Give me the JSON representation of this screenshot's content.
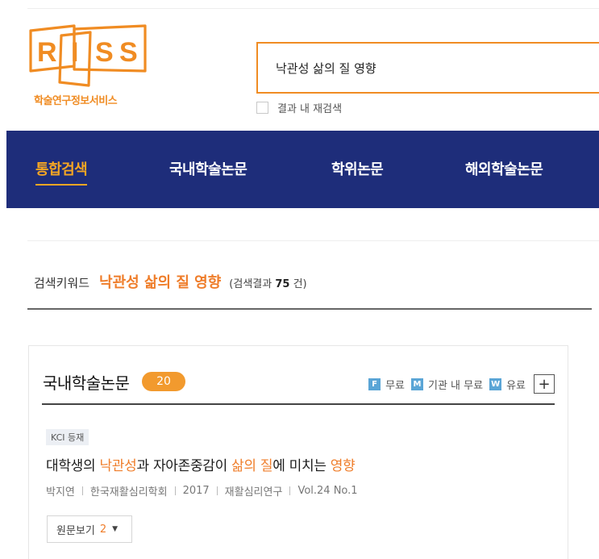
{
  "logo": {
    "letters": [
      "R",
      "I",
      "S",
      "S"
    ],
    "subtitle": "학술연구정보서비스",
    "accent_color": "#f08c23"
  },
  "search": {
    "value": "낙관성 삶의 질 영향",
    "research_label": "결과 내 재검색",
    "research_checked": false
  },
  "nav": {
    "background": "#1e2d7a",
    "active_color": "#f5a623",
    "items": [
      {
        "label": "통합검색",
        "active": true
      },
      {
        "label": "국내학술논문",
        "active": false
      },
      {
        "label": "학위논문",
        "active": false
      },
      {
        "label": "해외학술논문",
        "active": false
      }
    ]
  },
  "summary": {
    "keyword_label": "검색키워드",
    "keyword": "낙관성 삶의 질 영향",
    "result_prefix": "(검색결과 ",
    "result_count": "75",
    "result_suffix": " 건)"
  },
  "section": {
    "title": "국내학술논문",
    "count": "20",
    "legend": [
      {
        "badge": "F",
        "label": "무료",
        "icon": "free-badge-icon"
      },
      {
        "badge": "M",
        "label": "기관 내 무료",
        "icon": "institution-free-badge-icon"
      },
      {
        "badge": "W",
        "label": "유료",
        "icon": "paid-badge-icon"
      }
    ],
    "expand_symbol": "+"
  },
  "result": {
    "tag": "KCI 등재",
    "title_parts": [
      {
        "text": "대학생의 ",
        "hl": false
      },
      {
        "text": "낙관성",
        "hl": true
      },
      {
        "text": "과 자아존중감이 ",
        "hl": false
      },
      {
        "text": "삶의 질",
        "hl": true
      },
      {
        "text": "에 미치는 ",
        "hl": false
      },
      {
        "text": "영향",
        "hl": true
      }
    ],
    "meta": [
      "박지연",
      "한국재활심리학회",
      "2017",
      "재활심리연구",
      "Vol.24 No.1"
    ],
    "view_label": "원문보기",
    "view_count": "2",
    "view_caret": "▼"
  }
}
